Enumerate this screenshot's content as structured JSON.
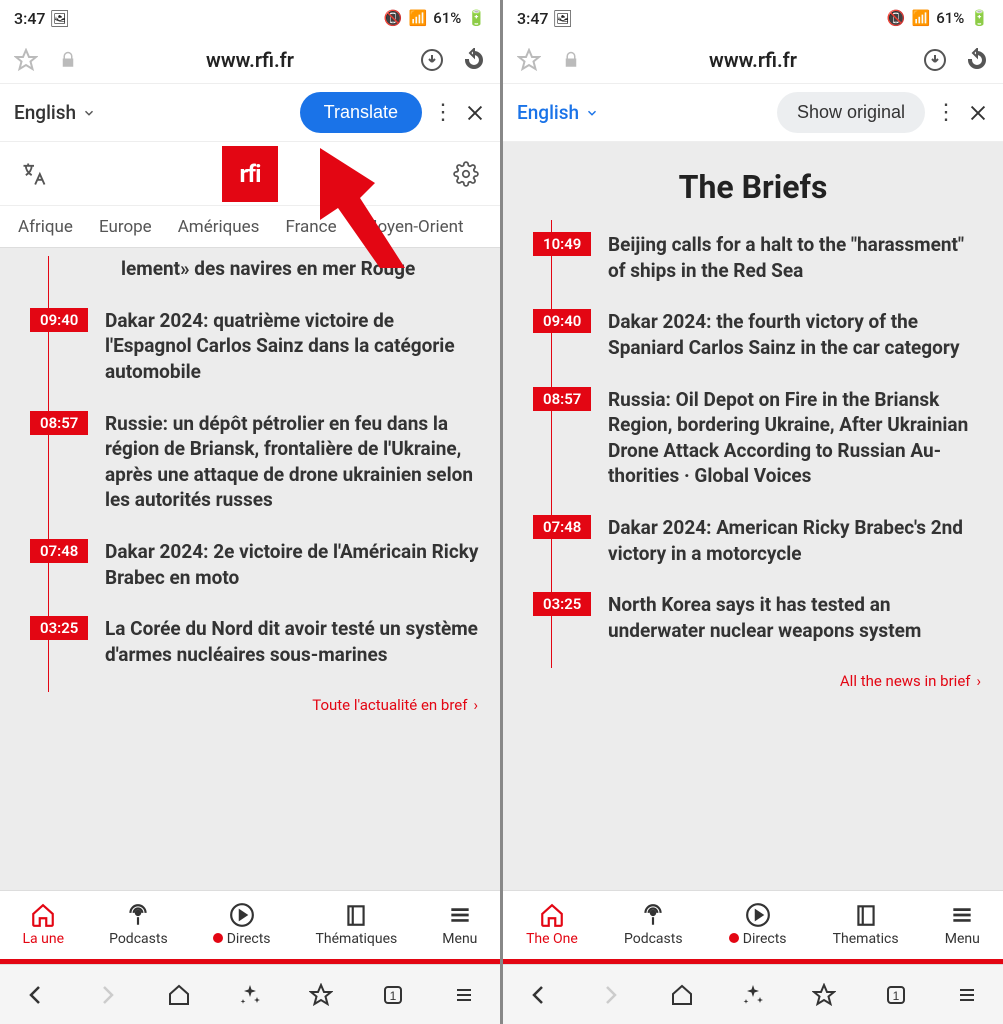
{
  "statusbar": {
    "time": "3:47",
    "battery": "61%"
  },
  "url": "www.rfi.fr",
  "left": {
    "lang": "English",
    "translate_btn": "Translate",
    "logo": "rfi",
    "navtabs": [
      "Afrique",
      "Europe",
      "Amériques",
      "France",
      "Moyen-Orient"
    ],
    "briefs": [
      {
        "time": "",
        "text": "lement» des navires en mer Rouge"
      },
      {
        "time": "09:40",
        "text": "Dakar 2024: quatrième victoire de l'Espagnol Carlos Sainz dans la catégorie automobile"
      },
      {
        "time": "08:57",
        "text": "Russie: un dépôt pétrolier en feu dans la région de Briansk, fronta­lière de l'Ukraine, après une at­taque de drone ukrainien selon les autorités russes"
      },
      {
        "time": "07:48",
        "text": "Dakar 2024: 2e victoire de l'Amé­ricain Ricky Brabec en moto"
      },
      {
        "time": "03:25",
        "text": "La Corée du Nord dit avoir testé un système d'armes nucléaires sous-marines"
      }
    ],
    "more": "Toute l'actualité en bref",
    "sitenav": [
      "La une",
      "Podcasts",
      "Directs",
      "Thématiques",
      "Menu"
    ]
  },
  "right": {
    "lang": "English",
    "showoriginal_btn": "Show original",
    "section_title": "The Briefs",
    "briefs": [
      {
        "time": "10:49",
        "text": "Beijing calls for a halt to the \"ha­rassment\" of ships in the Red Sea"
      },
      {
        "time": "09:40",
        "text": "Dakar 2024: the fourth victory of the Spaniard Carlos Sainz in the car category"
      },
      {
        "time": "08:57",
        "text": "Russia: Oil Depot on Fire in the Briansk Region, bordering Ukraine, After Ukrainian Drone Attack According to Russian Au­thorities · Global Voices"
      },
      {
        "time": "07:48",
        "text": "Dakar 2024: American Ricky Bra­bec's 2nd victory in a motorcycle"
      },
      {
        "time": "03:25",
        "text": "North Korea says it has tested an underwater nuclear weapons system"
      }
    ],
    "more": "All the news in brief",
    "sitenav": [
      "The One",
      "Podcasts",
      "Directs",
      "Thematics",
      "Menu"
    ]
  }
}
